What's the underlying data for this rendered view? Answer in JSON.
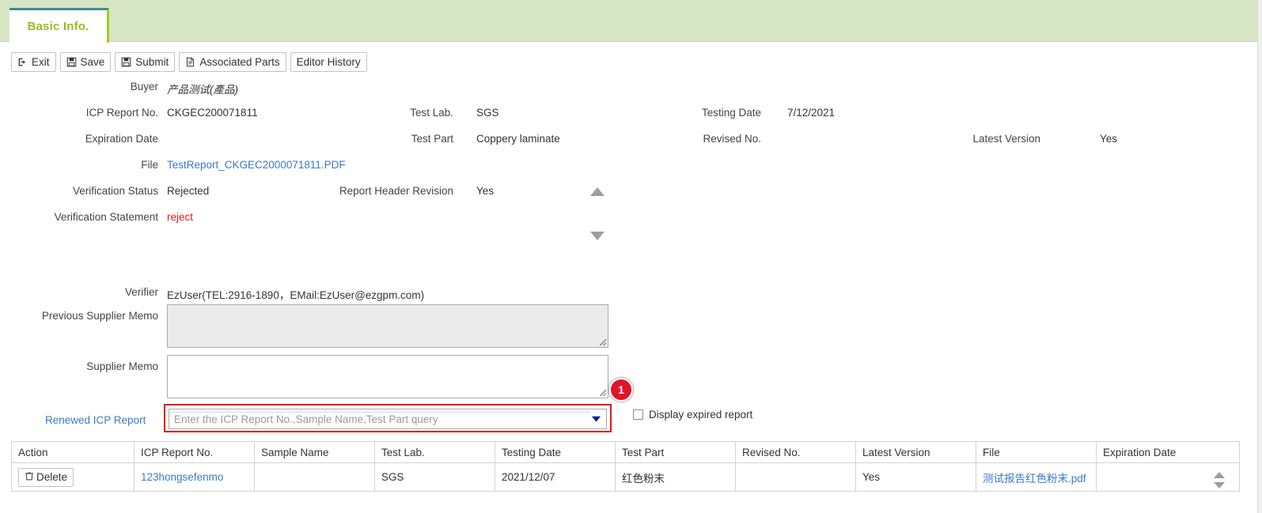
{
  "tab": {
    "label": "Basic Info."
  },
  "toolbar": {
    "exit": "Exit",
    "save": "Save",
    "submit": "Submit",
    "associated_parts": "Associated Parts",
    "editor_history": "Editor History"
  },
  "form": {
    "buyer_label": "Buyer",
    "buyer_value": "产品测试(產品)",
    "icp_report_no_label": "ICP Report No.",
    "icp_report_no_value": "CKGEC200071811",
    "test_lab_label": "Test Lab.",
    "test_lab_value": "SGS",
    "testing_date_label": "Testing Date",
    "testing_date_value": "7/12/2021",
    "expiration_date_label": "Expiration Date",
    "expiration_date_value": "",
    "test_part_label": "Test Part",
    "test_part_value": "Coppery laminate",
    "revised_no_label": "Revised No.",
    "revised_no_value": "",
    "latest_version_label": "Latest Version",
    "latest_version_value": "Yes",
    "file_label": "File",
    "file_value": "TestReport_CKGEC2000071811.PDF",
    "verification_status_label": "Verification Status",
    "verification_status_value": "Rejected",
    "report_header_revision_label": "Report Header Revision",
    "report_header_revision_value": "Yes",
    "verification_statement_label": "Verification Statement",
    "verification_statement_value": "reject",
    "verifier_label": "Verifier",
    "verifier_value": "EzUser(TEL:2916-1890，EMail:EzUser@ezgpm.com)",
    "previous_supplier_memo_label": "Previous Supplier Memo",
    "previous_supplier_memo_value": "",
    "supplier_memo_label": "Supplier Memo",
    "supplier_memo_value": "",
    "renewed_icp_report_label": "Renewed ICP Report",
    "renewed_icp_report_placeholder": "Enter the ICP Report No.,Sample Name,Test Part query",
    "renewed_icp_report_value": "",
    "badge_number": "1",
    "display_expired_report_label": "Display expired report"
  },
  "table": {
    "headers": [
      "Action",
      "ICP Report No.",
      "Sample Name",
      "Test Lab.",
      "Testing Date",
      "Test Part",
      "Revised No.",
      "Latest Version",
      "File",
      "Expiration Date"
    ],
    "rows": [
      {
        "action": "Delete",
        "icp_report_no": "123hongsefenmo",
        "sample_name": "",
        "test_lab": "SGS",
        "testing_date": "2021/12/07",
        "test_part": "红色粉末",
        "revised_no": "",
        "latest_version": "Yes",
        "file": "测试报告红色粉末.pdf",
        "expiration_date": ""
      }
    ]
  },
  "colors": {
    "band": "#d6e6c4",
    "tab_text": "#9cbb1f",
    "tab_top_border": "#3d8b91",
    "tab_right_border": "#a5c72b",
    "link": "#3b79c4",
    "alert": "#e01b1b",
    "badge": "#e2142a"
  }
}
